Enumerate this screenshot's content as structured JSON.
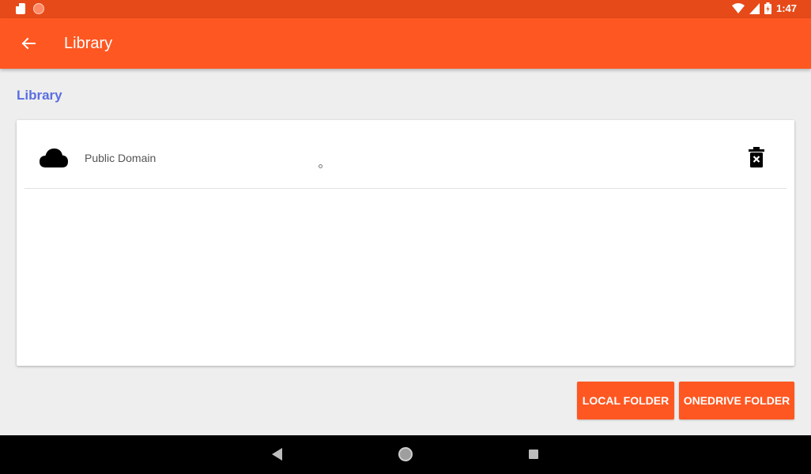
{
  "status_bar": {
    "time": "1:47",
    "icons": [
      "sd-card-icon",
      "notification-circle-icon",
      "wifi-icon",
      "signal-icon",
      "battery-icon"
    ]
  },
  "app_bar": {
    "title": "Library",
    "back_icon": "arrow-back-icon"
  },
  "section": {
    "title": "Library"
  },
  "library": {
    "items": [
      {
        "label": "Public Domain",
        "icon": "cloud-icon",
        "action_icon": "delete-icon"
      }
    ]
  },
  "buttons": {
    "local_folder": "LOCAL FOLDER",
    "onedrive_folder": "ONEDRIVE FOLDER"
  },
  "nav_bar": {
    "icons": [
      "nav-back-icon",
      "nav-home-icon",
      "nav-recents-icon"
    ]
  },
  "colors": {
    "status_bar": "#e64a19",
    "app_bar": "#ff5722",
    "accent_text": "#5a6ee0",
    "background": "#eeeeee"
  }
}
